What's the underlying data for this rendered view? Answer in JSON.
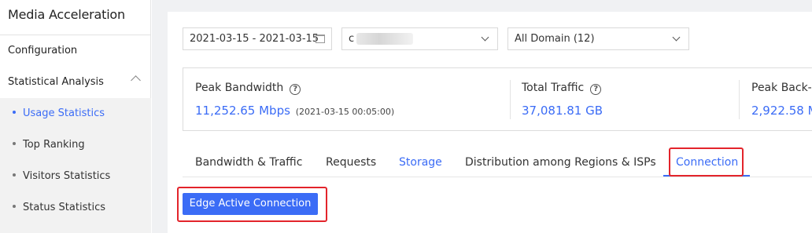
{
  "sidebar": {
    "title": "Media Acceleration",
    "items": [
      {
        "label": "Configuration"
      },
      {
        "label": "Statistical Analysis"
      }
    ],
    "subitems": [
      {
        "label": "Usage Statistics",
        "active": true
      },
      {
        "label": "Top Ranking"
      },
      {
        "label": "Visitors Statistics"
      },
      {
        "label": "Status Statistics"
      }
    ]
  },
  "filters": {
    "date_range": "2021-03-15 - 2021-03-15",
    "account_prefix": "c",
    "domain": "All Domain (12)"
  },
  "stats": [
    {
      "label": "Peak Bandwidth",
      "value": "11,252.65 Mbps",
      "timestamp": "(2021-03-15 00:05:00)"
    },
    {
      "label": "Total Traffic",
      "value": "37,081.81 GB"
    },
    {
      "label": "Peak Back-t",
      "value": "2,922.58 M"
    }
  ],
  "tabs": [
    {
      "label": "Bandwidth & Traffic"
    },
    {
      "label": "Requests"
    },
    {
      "label": "Storage"
    },
    {
      "label": "Distribution among Regions & ISPs"
    },
    {
      "label": "Connection",
      "active": true
    }
  ],
  "sub_tab": {
    "label": "Edge Active Connection"
  },
  "colors": {
    "accent": "#3b6cf6",
    "highlight": "#e3242b"
  }
}
